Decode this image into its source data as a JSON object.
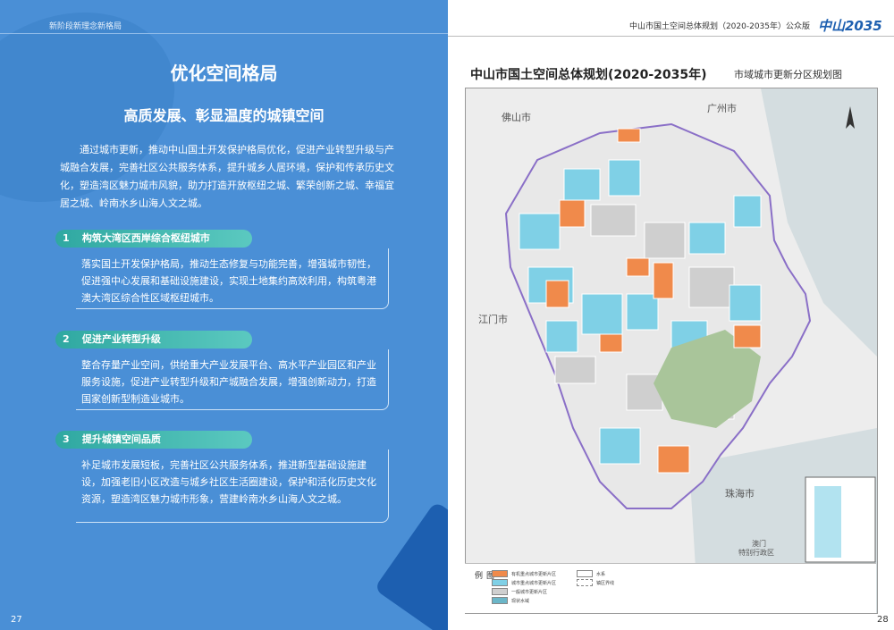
{
  "left_page": {
    "header": "新阶段新理念新格局",
    "section_title": "优化空间格局",
    "subtitle": "高质发展、彰显温度的城镇空间",
    "intro": "通过城市更新，推动中山国土开发保护格局优化，促进产业转型升级与产城融合发展，完善社区公共服务体系，提升城乡人居环境，保护和传承历史文化，塑造湾区魅力城市风貌，助力打造开放枢纽之城、繁荣创新之城、幸福宜居之城、岭南水乡山海人文之城。",
    "items": [
      {
        "num": "1",
        "title": "构筑大湾区西岸综合枢纽城市",
        "text": "落实国土开发保护格局，推动生态修复与功能完善，增强城市韧性，促进强中心发展和基础设施建设，实现土地集约高效利用，构筑粤港澳大湾区综合性区域枢纽城市。"
      },
      {
        "num": "2",
        "title": "促进产业转型升级",
        "text": "整合存量产业空间，供给重大产业发展平台、高水平产业园区和产业服务设施，促进产业转型升级和产城融合发展，增强创新动力，打造国家创新型制造业城市。"
      },
      {
        "num": "3",
        "title": "提升城镇空间品质",
        "text": "补足城市发展短板，完善社区公共服务体系，推进新型基础设施建设，加强老旧小区改造与城乡社区生活圈建设，保护和活化历史文化资源，塑造湾区魅力城市形象，营建岭南水乡山海人文之城。"
      }
    ],
    "page_number": "27"
  },
  "right_page": {
    "header": "中山市国土空间总体规划（2020-2035年）公众版",
    "logo_text": "中山2035",
    "map_title": "中山市国土空间总体规划(2020-2035年)",
    "map_subtitle": "市域城市更新分区规划图",
    "cities": {
      "foshan": "佛山市",
      "guangzhou": "广州市",
      "jiangmen": "江门市",
      "zhuhai": "珠海市",
      "macau": "澳门",
      "macau2": "特别行政区"
    },
    "legend_title": "图例",
    "legend": [
      {
        "label": "有机重点城市更新片区",
        "color": "#f08a4b"
      },
      {
        "label": "城市重点城市更新片区",
        "color": "#7fd0e6"
      },
      {
        "label": "一般城市更新片区",
        "color": "#cfcfcf"
      },
      {
        "label": "现状水域",
        "color": "#6bb6c8"
      },
      {
        "label": "水系",
        "color": "#ffffff"
      },
      {
        "label": "镇区界线",
        "color": "#ffffff"
      }
    ],
    "page_number": "28"
  }
}
